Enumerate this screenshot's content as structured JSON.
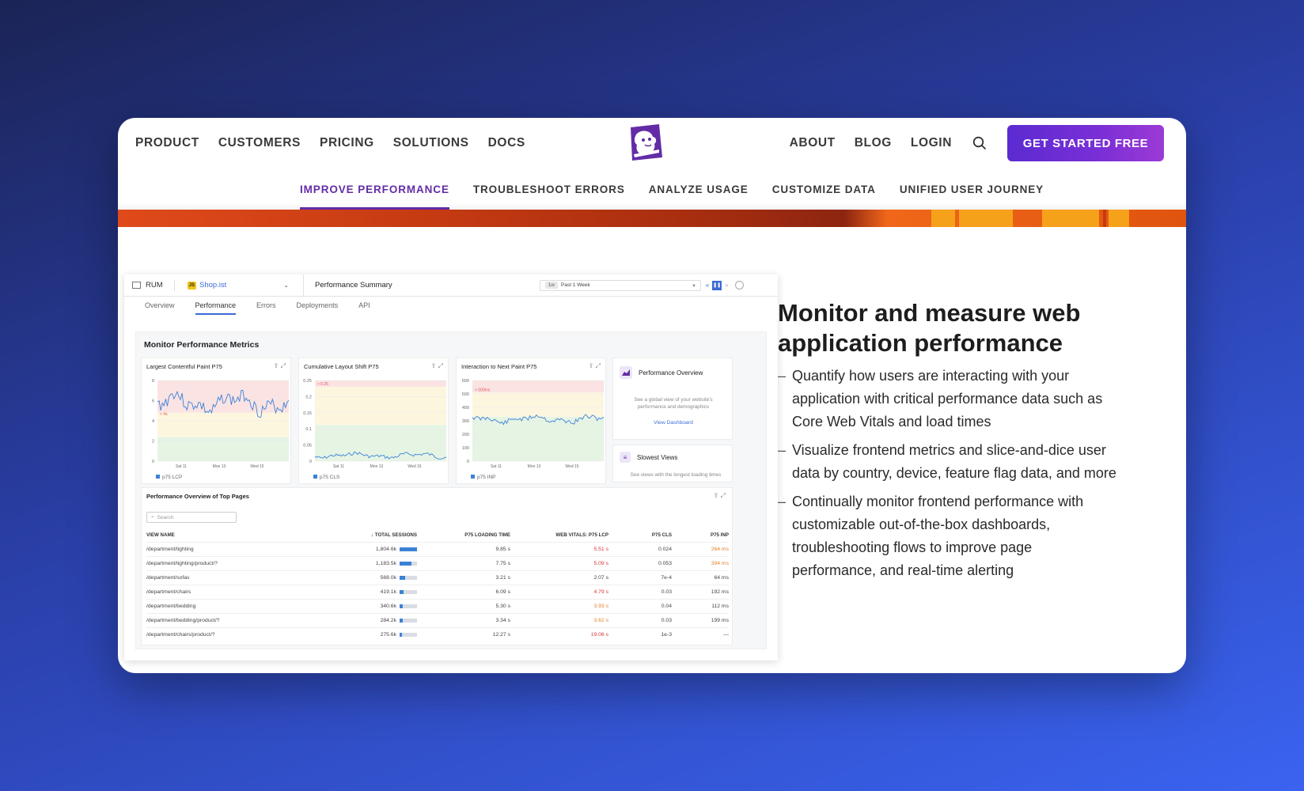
{
  "nav": {
    "left": [
      "PRODUCT",
      "CUSTOMERS",
      "PRICING",
      "SOLUTIONS",
      "DOCS"
    ],
    "right": [
      "ABOUT",
      "BLOG",
      "LOGIN"
    ],
    "cta": "GET STARTED FREE",
    "search_icon": "search-icon",
    "logo_icon": "dog-logo-icon"
  },
  "subnav": {
    "tabs": [
      "IMPROVE PERFORMANCE",
      "TROUBLESHOOT ERRORS",
      "ANALYZE USAGE",
      "CUSTOMIZE DATA",
      "UNIFIED USER JOURNEY"
    ],
    "active_index": 0
  },
  "colors": {
    "brand": "#632ca6",
    "accent_blue": "#3b82d6",
    "stripe_orange": "#e04a1a"
  },
  "dashboard": {
    "product": "RUM",
    "app": "Shop.ist",
    "app_badge": "JS",
    "page_title": "Performance Summary",
    "time_badge": "1w",
    "time_range": "Past 1 Week",
    "tabs": [
      "Overview",
      "Performance",
      "Errors",
      "Deployments",
      "API"
    ],
    "active_tab": 1,
    "section_title": "Monitor Performance Metrics",
    "widgets": [
      {
        "title": "Largest Contentful Paint P75",
        "legend": "p75 LCP",
        "y_ticks": [
          "8",
          "6",
          "4",
          "2",
          "0"
        ],
        "threshold": "> 4s",
        "x_ticks": [
          "Sat 11",
          "Mon 13",
          "Wed 15"
        ]
      },
      {
        "title": "Cumulative Layout Shift P75",
        "legend": "p75 CLS",
        "y_ticks": [
          "0.25",
          "0.2",
          "0.15",
          "0.1",
          "0.05",
          "0"
        ],
        "threshold": "> 0.25",
        "x_ticks": [
          "Sat 11",
          "Mon 13",
          "Wed 15"
        ]
      },
      {
        "title": "Interaction to Next Paint P75",
        "legend": "p75 INP",
        "y_ticks": [
          "600",
          "500",
          "400",
          "300",
          "200",
          "100",
          "0"
        ],
        "threshold": "> 500ms",
        "x_ticks": [
          "Sat 11",
          "Mon 13",
          "Wed 15"
        ]
      }
    ],
    "side_cards": [
      {
        "title": "Performance Overview",
        "desc": "See a global view of your website's performance and demographics",
        "link": "View Dashboard"
      },
      {
        "title": "Slowest Views",
        "desc": "See views with the longest loading times"
      }
    ],
    "table": {
      "title": "Performance Overview of Top Pages",
      "search_placeholder": "Search",
      "columns": [
        "VIEW NAME",
        "TOTAL SESSIONS",
        "P75 LOADING TIME",
        "WEB VITALS: P75 LCP",
        "P75 CLS",
        "P75 INP"
      ],
      "rows": [
        [
          "/department/lighting",
          "1,804.6k",
          "9.85 s",
          "5.51 s",
          "0.024",
          "264 ms"
        ],
        [
          "/department/lighting/product/?",
          "1,183.5k",
          "7.75 s",
          "5.09 s",
          "0.053",
          "394 ms"
        ],
        [
          "/department/sofas",
          "568.0k",
          "3.21 s",
          "2.07 s",
          "7e-4",
          "64 ms"
        ],
        [
          "/department/chairs",
          "419.1k",
          "6.09 s",
          "4.79 s",
          "0.03",
          "192 ms"
        ],
        [
          "/department/bedding",
          "340.6k",
          "5.30 s",
          "3.93 s",
          "0.04",
          "112 ms"
        ],
        [
          "/department/bedding/product/?",
          "284.2k",
          "3.34 s",
          "3.62 s",
          "0.03",
          "199 ms"
        ],
        [
          "/department/chairs/product/?",
          "275.6k",
          "12.27 s",
          "19.06 s",
          "1e-3",
          "—"
        ]
      ],
      "session_fill": [
        1.0,
        0.66,
        0.32,
        0.24,
        0.19,
        0.16,
        0.15
      ]
    }
  },
  "content": {
    "headline": "Monitor and measure web application performance",
    "bullets": [
      "Quantify how users are interacting with your application with critical performance data such as Core Web Vitals and load times",
      "Visualize frontend metrics and slice-and-dice user data by country, device, feature flag data, and more",
      "Continually monitor frontend performance with customizable out-of-the-box dashboards, troubleshooting flows to improve page performance, and real-time alerting"
    ]
  }
}
